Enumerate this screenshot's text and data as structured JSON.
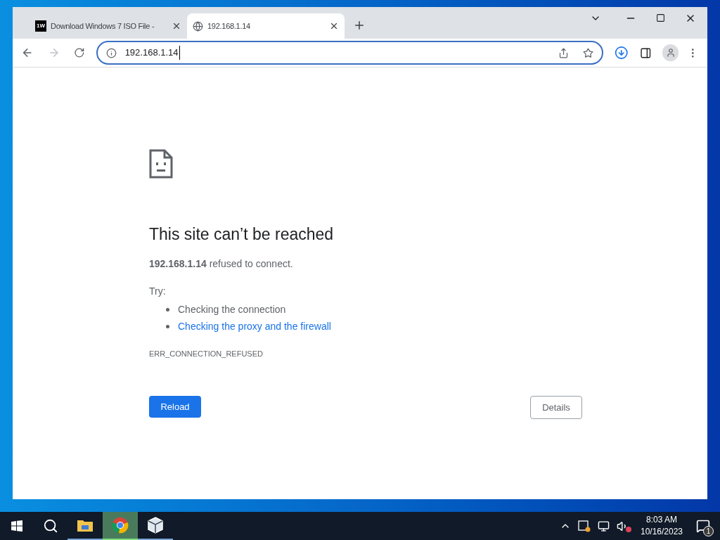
{
  "tabs": [
    {
      "title": "Download Windows 7 ISO File -",
      "favicon_text": "1W",
      "kind": "logo",
      "selected": false
    },
    {
      "title": "192.168.1.14",
      "kind": "globe",
      "selected": true
    }
  ],
  "address_bar": {
    "value": "192.168.1.14"
  },
  "error_page": {
    "title": "This site can’t be reached",
    "message": "**192.168.1.14** refused to connect.",
    "try_label": "Try:",
    "suggestions": [
      {
        "text": "Checking the connection",
        "kind": "text"
      },
      {
        "text": "Checking the proxy and the firewall",
        "kind": "link"
      }
    ],
    "error_code": "ERR_CONNECTION_REFUSED",
    "reload_button": "Reload",
    "details_button": "Details"
  },
  "taskbar": {
    "apps": [
      {
        "kind": "folder",
        "selected": false
      },
      {
        "kind": "chrome",
        "selected": true
      },
      {
        "kind": "cube",
        "selected": false
      }
    ],
    "time": "8:03 AM",
    "date": "10/16/2023",
    "notification_count": "1"
  }
}
